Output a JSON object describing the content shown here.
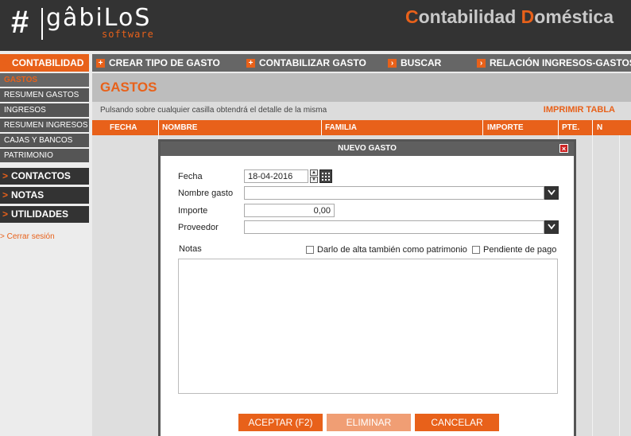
{
  "brand": {
    "hash": "#",
    "name": "gâbiLoS",
    "sub": "software"
  },
  "app_title": {
    "first_initial": "C",
    "first_rest": "ontabilidad ",
    "second_initial": "D",
    "second_rest": "oméstica"
  },
  "colors": {
    "accent": "#e8611a",
    "header_bg": "#333333",
    "nav_bg": "#666666"
  },
  "nav": {
    "active": {
      "chevron": ">",
      "label": "CONTABILIDAD"
    },
    "items": [
      {
        "icon": "plus-icon",
        "glyph": "+",
        "label": "CREAR TIPO DE GASTO"
      },
      {
        "icon": "plus-icon",
        "glyph": "+",
        "label": "CONTABILIZAR GASTO"
      },
      {
        "icon": "arrow-right-icon",
        "glyph": "›",
        "label": "BUSCAR"
      },
      {
        "icon": "arrow-right-icon",
        "glyph": "›",
        "label": "RELACIÓN INGRESOS-GASTOS"
      }
    ]
  },
  "sidebar": {
    "items": [
      {
        "label": "GASTOS",
        "active": true
      },
      {
        "label": "RESUMEN GASTOS"
      },
      {
        "label": "INGRESOS"
      },
      {
        "label": "RESUMEN INGRESOS"
      },
      {
        "label": "CAJAS Y BANCOS"
      },
      {
        "label": "PATRIMONIO"
      }
    ],
    "sections": [
      {
        "chevron": ">",
        "label": "CONTACTOS"
      },
      {
        "chevron": ">",
        "label": "NOTAS"
      },
      {
        "chevron": ">",
        "label": "UTILIDADES"
      }
    ],
    "logout": "> Cerrar sesión"
  },
  "main": {
    "title": "GASTOS",
    "info": "Pulsando sobre cualquier casilla obtendrá el detalle de la misma",
    "print": "IMPRIMIR TABLA",
    "columns": [
      "FECHA",
      "NOMBRE",
      "FAMILIA",
      "IMPORTE",
      "PTE.",
      "N"
    ]
  },
  "modal": {
    "title": "NUEVO GASTO",
    "close_glyph": "×",
    "fecha_label": "Fecha",
    "fecha_value": "18-04-2016",
    "nombre_label": "Nombre gasto",
    "nombre_value": "",
    "importe_label": "Importe",
    "importe_value": "0,00",
    "proveedor_label": "Proveedor",
    "proveedor_value": "",
    "notas_label": "Notas",
    "notas_value": "",
    "check_patrimonio": "Darlo de alta también como patrimonio",
    "check_pendiente": "Pendiente de pago",
    "btn_accept": "ACEPTAR (F2)",
    "btn_delete": "ELIMINAR",
    "btn_cancel": "CANCELAR"
  }
}
